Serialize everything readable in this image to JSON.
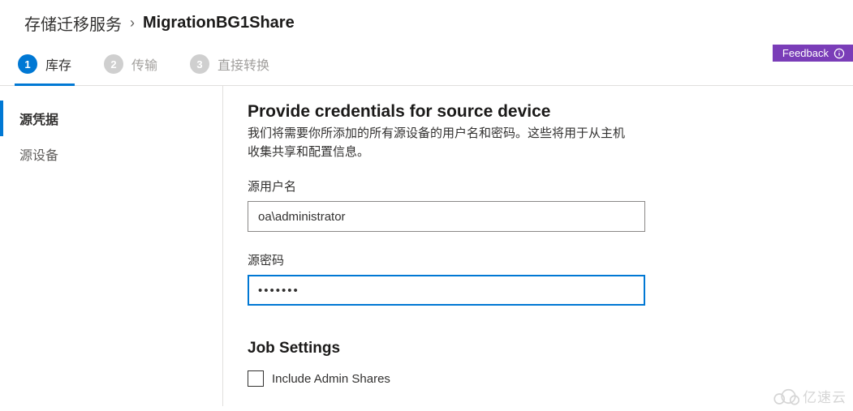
{
  "breadcrumb": {
    "parent": "存储迁移服务",
    "separator": "›",
    "current": "MigrationBG1Share"
  },
  "feedback": {
    "label": "Feedback"
  },
  "steps": [
    {
      "num": "1",
      "label": "库存",
      "active": true
    },
    {
      "num": "2",
      "label": "传输",
      "active": false
    },
    {
      "num": "3",
      "label": "直接转换",
      "active": false
    }
  ],
  "sidebar": {
    "items": [
      {
        "label": "源凭据",
        "active": true
      },
      {
        "label": "源设备",
        "active": false
      }
    ]
  },
  "main": {
    "heading": "Provide credentials for source device",
    "description": "我们将需要你所添加的所有源设备的用户名和密码。这些将用于从主机收集共享和配置信息。",
    "username_label": "源用户名",
    "username_value": "oa\\administrator",
    "password_label": "源密码",
    "password_value": "•••••••",
    "job_settings_heading": "Job Settings",
    "include_admin_shares_label": "Include Admin Shares",
    "include_admin_shares_checked": false
  },
  "watermark": {
    "text": "亿速云"
  }
}
